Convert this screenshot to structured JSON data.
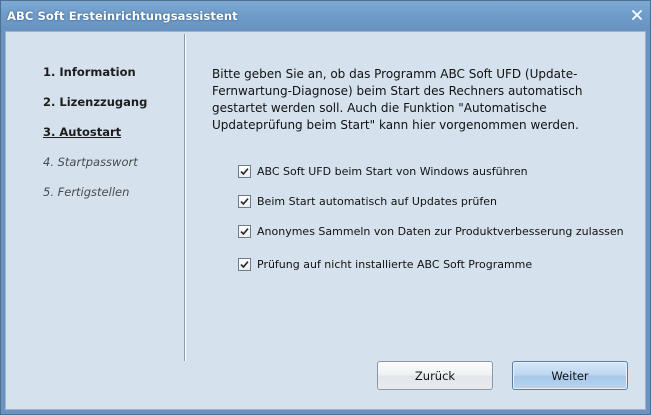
{
  "window": {
    "title": "ABC Soft Ersteinrichtungsassistent",
    "close_icon": "close-icon"
  },
  "steps": [
    {
      "label": "1. Information",
      "state": "done"
    },
    {
      "label": "2. Lizenzzugang",
      "state": "done"
    },
    {
      "label": "3. Autostart",
      "state": "current"
    },
    {
      "label": "4. Startpasswort",
      "state": "pending"
    },
    {
      "label": "5. Fertigstellen",
      "state": "pending"
    }
  ],
  "main": {
    "intro": "Bitte geben Sie an, ob das Programm ABC Soft UFD (Update-Fernwartung-Diagnose) beim Start des Rechners automatisch gestartet werden soll. Auch die Funktion \"Automatische Updateprüfung beim Start\" kann hier vorgenommen werden.",
    "options": [
      {
        "label": "ABC Soft UFD beim Start von Windows ausführen",
        "checked": true
      },
      {
        "label": "Beim Start automatisch auf Updates prüfen",
        "checked": true
      },
      {
        "label": "Anonymes Sammeln von Daten zur Produktverbesserung zulassen",
        "checked": true
      },
      {
        "label": "Prüfung auf nicht installierte ABC Soft Programme",
        "checked": true
      }
    ]
  },
  "buttons": {
    "back": "Zurück",
    "next": "Weiter"
  },
  "colors": {
    "titlebar": "#6f9cc9",
    "client_bg": "#d5e2ee",
    "primary_button": "#b6d3f1"
  }
}
